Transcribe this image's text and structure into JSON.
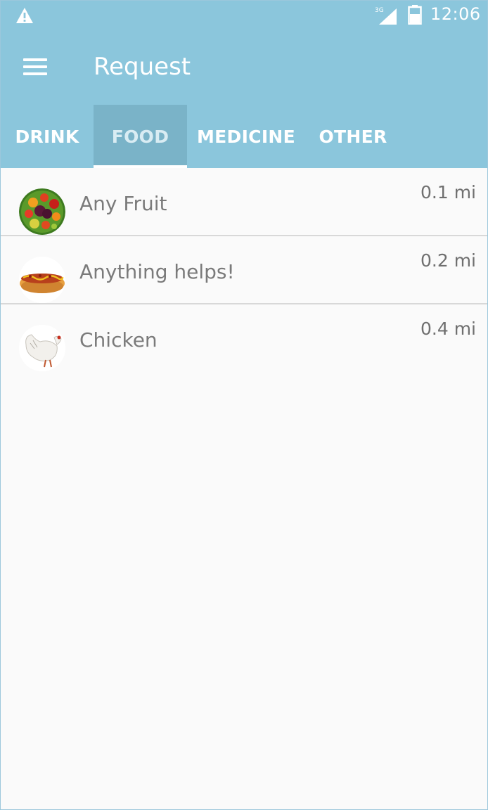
{
  "status_bar": {
    "time": "12:06",
    "network_label": "3G",
    "icons": [
      "warning-icon",
      "signal-icon",
      "battery-icon"
    ]
  },
  "toolbar": {
    "title": "Request",
    "menu_icon": "hamburger-menu-icon"
  },
  "tabs": [
    {
      "label": "DRINK",
      "active": false
    },
    {
      "label": "FOOD",
      "active": true
    },
    {
      "label": "MEDICINE",
      "active": false
    },
    {
      "label": "OTHER",
      "active": false
    }
  ],
  "requests": [
    {
      "title": "Any Fruit",
      "distance": "0.1 mi",
      "icon": "fruit-bowl-image"
    },
    {
      "title": "Anything helps!",
      "distance": "0.2 mi",
      "icon": "hot-dog-image"
    },
    {
      "title": "Chicken",
      "distance": "0.4 mi",
      "icon": "chicken-image"
    }
  ],
  "colors": {
    "app_bar": "#8bc6dc",
    "active_tab": "#7ab3c8",
    "background": "#fafafa",
    "divider": "#d8d8d8"
  }
}
